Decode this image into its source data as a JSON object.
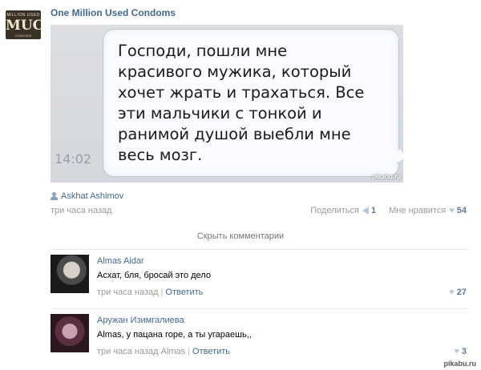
{
  "logo": {
    "top": "MILLION USED",
    "main": "MUC",
    "bottom": "CONDOMS"
  },
  "post": {
    "group_name": "One Million Used Condoms",
    "photo": {
      "message": "Господи, пошли мне\nкрасивого мужика, который\nхочет жрать и трахаться. Все\nэти мальчики с тонкой и\nранимой душой выебли мне\nвесь мозг.",
      "time": "14:02",
      "watermark": "pikabu.ru"
    },
    "author": "Askhat Ashimov",
    "time": "три часа назад",
    "share_label": "Поделиться",
    "share_count": "1",
    "like_label": "Мне нравится",
    "like_count": "54"
  },
  "hide_comments": "Скрыть комментарии",
  "comments": [
    {
      "author": "Almas Aidar",
      "text": "Асхат, бля, бросай это дело",
      "time": "три часа назад",
      "reply": "Ответить",
      "likes": "27"
    },
    {
      "author": "Аружан Изимгалиева",
      "text": "Almas, у пацана горе, а ты угараешь,,",
      "time": "три часа назад",
      "reply_to": "Almas",
      "reply": "Ответить",
      "likes": "3"
    }
  ],
  "footer_watermark": "pikabu.ru",
  "colors": {
    "link": "#45688e",
    "muted": "#999999"
  }
}
